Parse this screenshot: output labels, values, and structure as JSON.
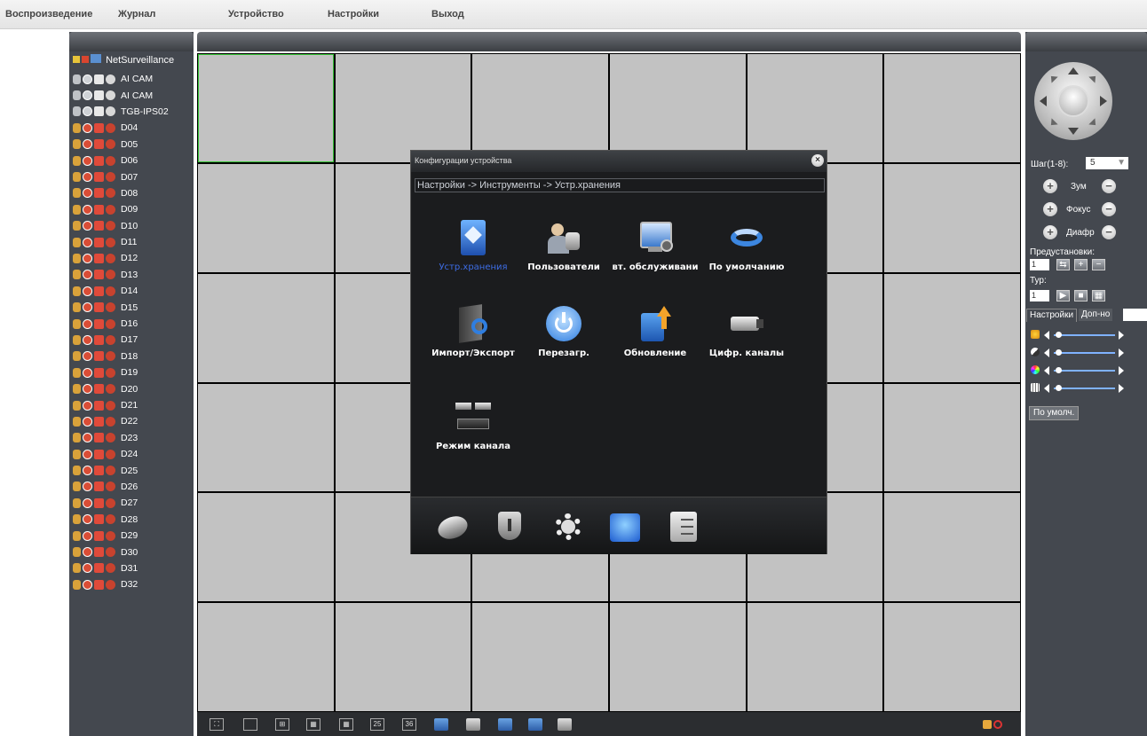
{
  "menu": [
    "Воспроизведение",
    "Журнал",
    "Устройство",
    "Настройки",
    "Выход"
  ],
  "device_tree": {
    "root": "NetSurveillance",
    "channels": [
      {
        "name": "AI CAM",
        "online": true
      },
      {
        "name": "AI CAM",
        "online": true
      },
      {
        "name": "TGB-IPS02",
        "online": true
      },
      {
        "name": "D04",
        "online": false
      },
      {
        "name": "D05",
        "online": false
      },
      {
        "name": "D06",
        "online": false
      },
      {
        "name": "D07",
        "online": false
      },
      {
        "name": "D08",
        "online": false
      },
      {
        "name": "D09",
        "online": false
      },
      {
        "name": "D10",
        "online": false
      },
      {
        "name": "D11",
        "online": false
      },
      {
        "name": "D12",
        "online": false
      },
      {
        "name": "D13",
        "online": false
      },
      {
        "name": "D14",
        "online": false
      },
      {
        "name": "D15",
        "online": false
      },
      {
        "name": "D16",
        "online": false
      },
      {
        "name": "D17",
        "online": false
      },
      {
        "name": "D18",
        "online": false
      },
      {
        "name": "D19",
        "online": false
      },
      {
        "name": "D20",
        "online": false
      },
      {
        "name": "D21",
        "online": false
      },
      {
        "name": "D22",
        "online": false
      },
      {
        "name": "D23",
        "online": false
      },
      {
        "name": "D24",
        "online": false
      },
      {
        "name": "D25",
        "online": false
      },
      {
        "name": "D26",
        "online": false
      },
      {
        "name": "D27",
        "online": false
      },
      {
        "name": "D28",
        "online": false
      },
      {
        "name": "D29",
        "online": false
      },
      {
        "name": "D30",
        "online": false
      },
      {
        "name": "D31",
        "online": false
      },
      {
        "name": "D32",
        "online": false
      }
    ]
  },
  "bottom_toolbar": {
    "split_25": "25",
    "split_36": "36"
  },
  "ptz": {
    "step_label": "Шаг(1-8):",
    "step_value": "5",
    "zoom_label": "Зум",
    "focus_label": "Фокус",
    "iris_label": "Диафр",
    "presets_label": "Предустановки:",
    "preset_value": "1",
    "tour_label": "Тур:",
    "tour_value": "1"
  },
  "image_settings": {
    "tab_settings": "Настройки",
    "tab_extra": "Доп-но",
    "default_button": "По умолч."
  },
  "dialog": {
    "title": "Конфигурации устройства",
    "breadcrumb": "Настройки -> Инструменты -> Устр.хранения",
    "items": [
      "Устр.хранения",
      "Пользователи",
      "вт. обслуживани",
      "По умолчанию",
      "Импорт/Экспорт",
      "Перезагр.",
      "Обновление",
      "Цифр. каналы",
      "Режим канала"
    ]
  },
  "colors": {
    "panel": "#44484f",
    "selected_cell": "#35c335",
    "active_item": "#3d6de6",
    "cell": "#c2c2c2"
  }
}
